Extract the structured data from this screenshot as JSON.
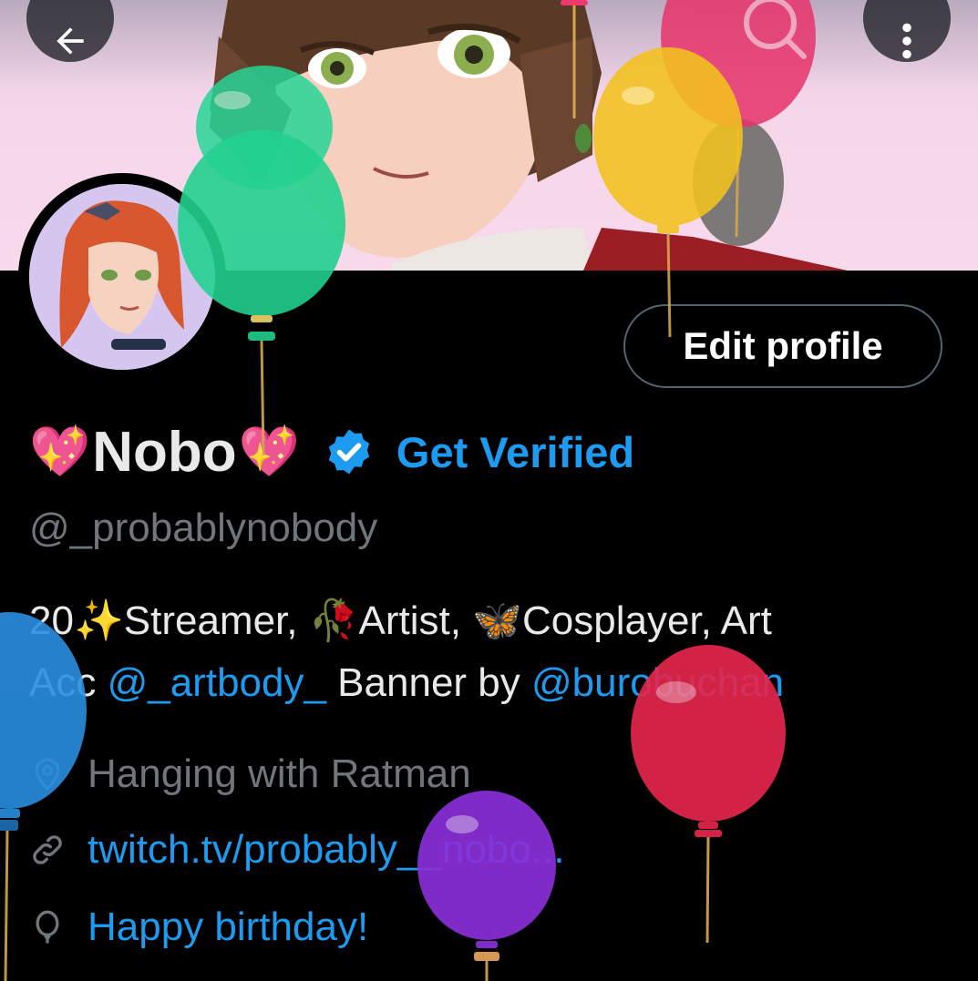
{
  "header": {
    "back_icon": "arrow-left-icon",
    "more_icon": "more-vertical-icon"
  },
  "profile": {
    "edit_button_label": "Edit profile",
    "name_prefix_emoji": "💖",
    "display_name": "Nobo",
    "name_suffix_emoji": "💖",
    "verified_icon": "verified-badge-icon",
    "get_verified_label": "Get Verified",
    "handle": "@_probablynobody"
  },
  "bio": {
    "age": "20",
    "sparkle_emoji": "✨",
    "part1": "Streamer, ",
    "rose_emoji": "🥀",
    "part2": "Artist, ",
    "butterfly_emoji": "🦋",
    "part3": "Cosplayer, Art",
    "part4": "Acc ",
    "mention1": "@_artbody_",
    "part5": " Banner by ",
    "mention2": "@burobuchan"
  },
  "meta": {
    "location": "Hanging with Ratman",
    "location_icon": "location-pin-icon",
    "website": "twitch.tv/probably__nobo...",
    "website_icon": "link-icon",
    "birthday": "Happy birthday!",
    "birthday_icon": "balloon-icon"
  },
  "colors": {
    "accent": "#1d9bf0",
    "secondary_text": "#71767b",
    "background": "#000000",
    "border": "#536471"
  }
}
